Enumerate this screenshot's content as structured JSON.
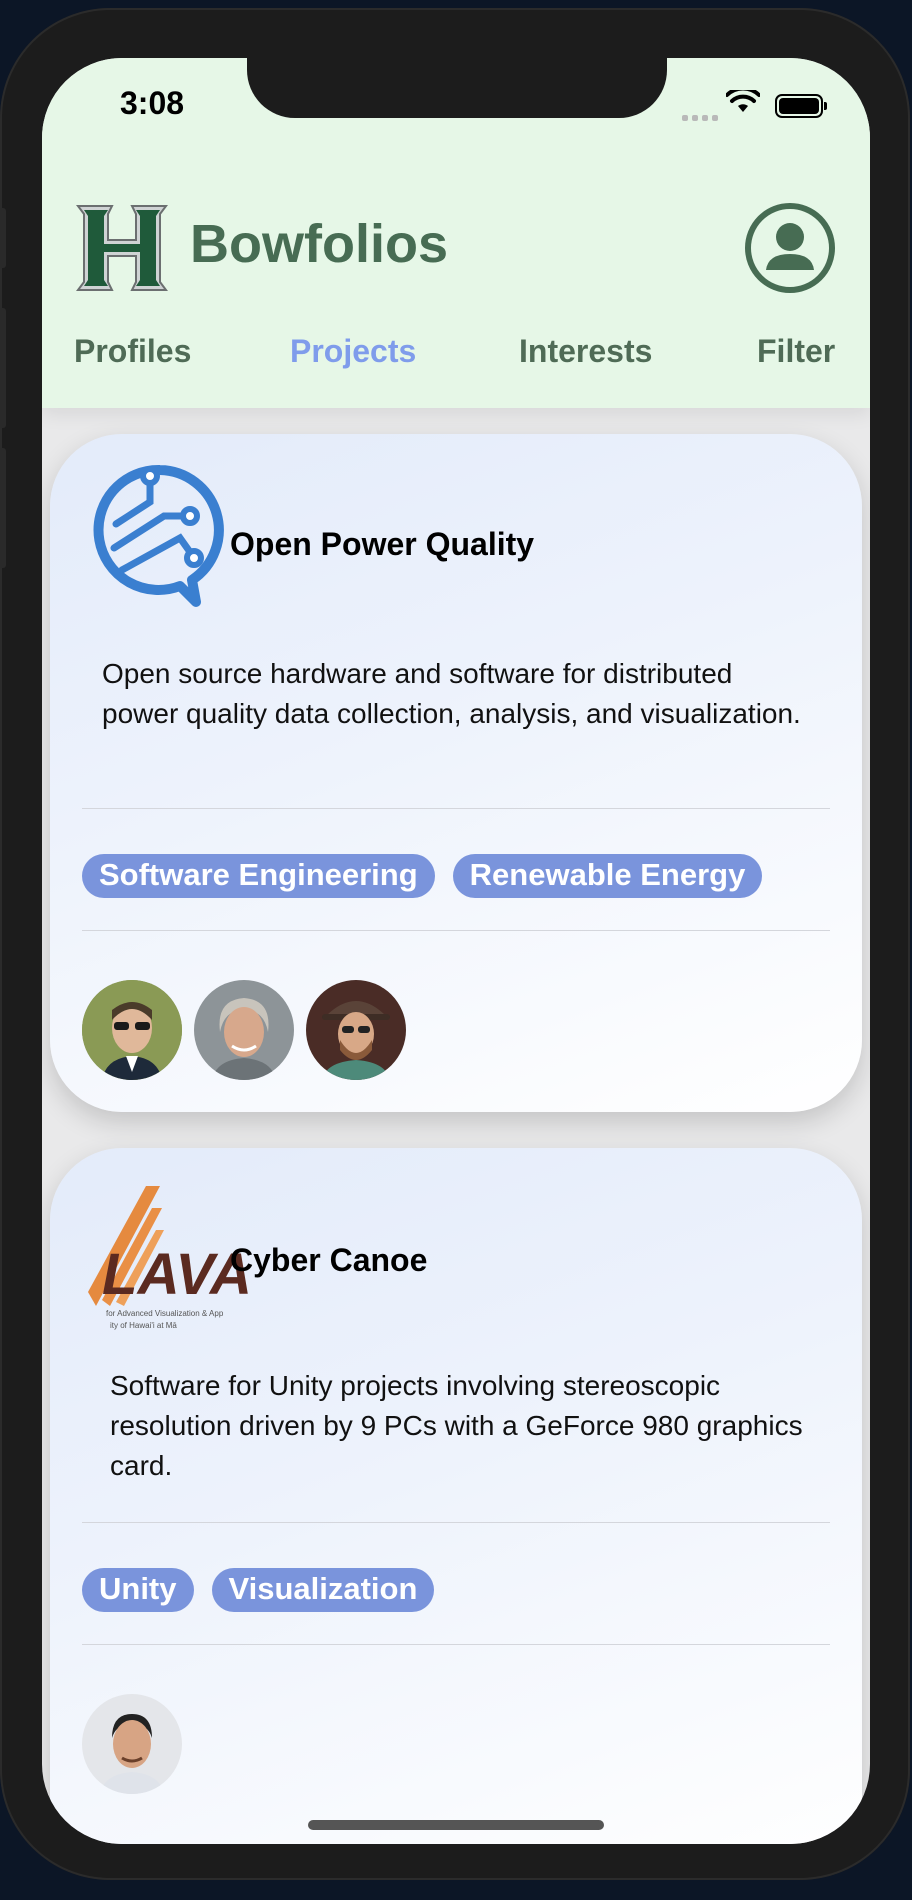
{
  "status_bar": {
    "time": "3:08"
  },
  "header": {
    "app_title": "Bowfolios",
    "logo_icon": "hawaii-h-logo",
    "profile_icon": "user-circle-icon",
    "tabs": [
      {
        "label": "Profiles",
        "active": false
      },
      {
        "label": "Projects",
        "active": true
      },
      {
        "label": "Interests",
        "active": false
      },
      {
        "label": "Filter",
        "active": false
      }
    ]
  },
  "projects": [
    {
      "logo_icon": "circuit-chat-icon",
      "title": "Open Power Quality",
      "description": "Open source hardware and software for distributed power quality data collection, analysis, and visualization.",
      "interests": [
        "Software Engineering",
        "Renewable Energy"
      ],
      "participants": [
        "avatar-1",
        "avatar-2",
        "avatar-3"
      ]
    },
    {
      "logo_icon": "lava-logo",
      "logo_text": "LAVA",
      "logo_caption_1": "for Advanced Visualization & App",
      "logo_caption_2": "ity of Hawai'i at Mā",
      "title": "Cyber Canoe",
      "description": "Software for Unity projects involving stereoscopic resolution driven by 9 PCs with a GeForce 980 graphics card.",
      "interests": [
        "Unity",
        "Visualization"
      ],
      "participants": [
        "avatar-4"
      ]
    }
  ],
  "colors": {
    "header_bg": "#e6f7e7",
    "brand_green": "#476c53",
    "active_tab": "#7f9ceb",
    "chip_bg": "#7a94dc"
  }
}
